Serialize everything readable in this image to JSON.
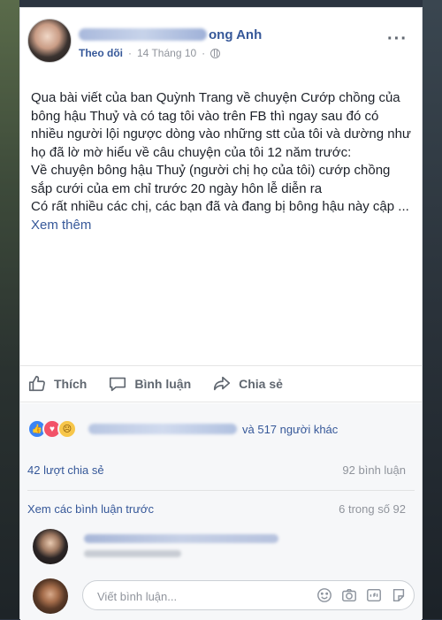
{
  "post": {
    "author_suffix": "ong Anh",
    "follow_label": "Theo dõi",
    "separator": "·",
    "date": "14 Tháng 10",
    "separator2": "·",
    "more_label": "···",
    "paragraphs": [
      "Qua bài viết của ban Quỳnh Trang về chuyện Cướp chồng của bông hậu Thuỷ và có tag tôi vào trên FB thì ngay sau đó có nhiều người lội ngược dòng vào những stt của tôi và dường như họ đã lờ mờ hiểu về câu chuyện của tôi 12 năm trước:",
      "Về chuyện bông hậu Thuỷ (người chị họ của tôi) cướp chồng sắp cưới của em chỉ trước 20 ngày hôn lễ diễn ra",
      "Có rất nhiều các chị, các bạn đã và đang bị bông hậu này cập ..."
    ],
    "see_more": "Xem thêm"
  },
  "actions": {
    "like": "Thích",
    "comment": "Bình luận",
    "share": "Chia sẻ"
  },
  "footer": {
    "and_others": "và 517 người khác",
    "shares": "42 lượt chia sẻ",
    "comments_count": "92 bình luận",
    "previous_comments": "Xem các bình luận trước",
    "previous_count": "6 trong số 92",
    "write_placeholder": "Viết bình luận..."
  },
  "colors": {
    "link": "#365899",
    "muted": "#90949c",
    "like": "#3b84f5",
    "love": "#f25268",
    "sad": "#f7c64a"
  },
  "icons": [
    "more-icon",
    "globe-icon",
    "like-icon",
    "comment-icon",
    "share-icon",
    "emoji-icon",
    "camera-icon",
    "gif-icon",
    "sticker-icon"
  ]
}
